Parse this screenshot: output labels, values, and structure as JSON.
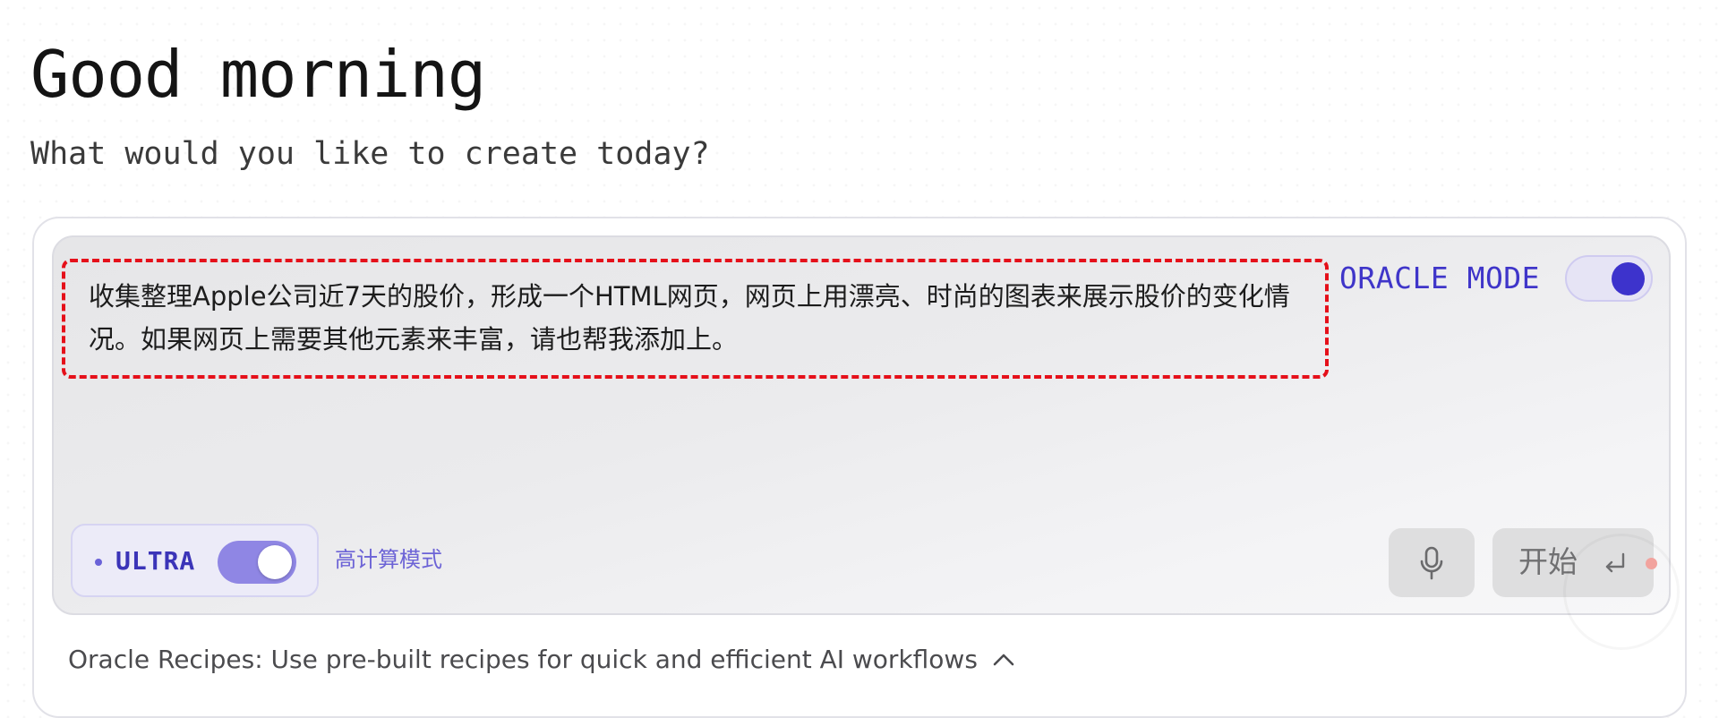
{
  "header": {
    "greeting": "Good morning",
    "subtitle": "What would you like to create today?"
  },
  "prompt": {
    "text": "收集整理Apple公司近7天的股价，形成一个HTML网页，网页上用漂亮、时尚的图表来展示股价的变化情况。如果网页上需要其他元素来丰富，请也帮我添加上。",
    "highlight_color": "#e5101a"
  },
  "oracle_mode": {
    "label": "ORACLE MODE",
    "enabled": true,
    "accent_color": "#3d33cc"
  },
  "ultra": {
    "label": "ULTRA",
    "enabled": true,
    "caption": "高计算模式",
    "accent_color": "#8f86e4"
  },
  "actions": {
    "mic_icon": "microphone-icon",
    "start_label": "开始",
    "start_icon": "enter-return-icon"
  },
  "recipes": {
    "text": "Oracle Recipes: Use pre-built recipes for quick and efficient AI workflows",
    "icon": "chevron-up-icon",
    "expanded": true
  }
}
